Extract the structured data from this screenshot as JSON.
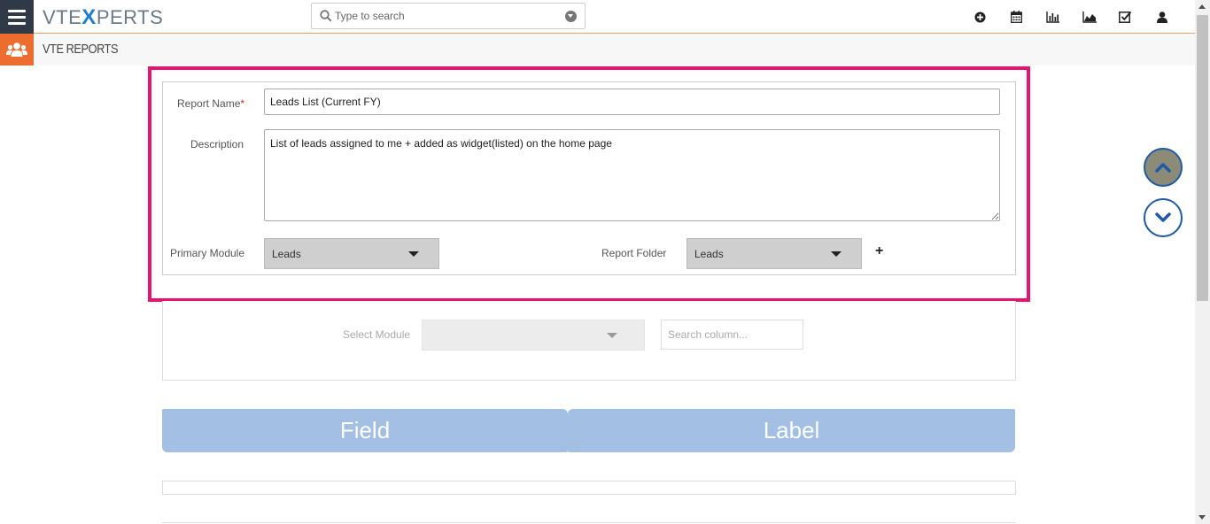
{
  "header": {
    "logo_left": "VTE",
    "logo_x": "X",
    "logo_right": "PERTS",
    "search_placeholder": "Type to search",
    "icons": [
      "plus-circle-icon",
      "calendar-icon",
      "bar-chart-icon",
      "area-chart-icon",
      "checkbox-icon",
      "user-icon"
    ]
  },
  "subheader": {
    "module_icon": "users-icon",
    "title": "VTE REPORTS"
  },
  "form": {
    "report_name_label": "Report Name",
    "required_mark": "*",
    "report_name_value": "Leads List (Current FY)",
    "description_label": "Description",
    "description_value": "List of leads assigned to me + added as widget(listed) on the home page",
    "primary_module_label": "Primary Module",
    "primary_module_value": "Leads",
    "report_folder_label": "Report Folder",
    "report_folder_value": "Leads",
    "add_folder_label": "+"
  },
  "module_select": {
    "label": "Select Module",
    "value": "",
    "search_placeholder": "Search column..."
  },
  "columns": {
    "field": "Field",
    "label": "Label"
  },
  "colors": {
    "highlight": "#e8136e",
    "brand_dark": "#2f3947",
    "module_orange": "#ec6d2e",
    "header_blue": "#a3bfe3",
    "scroll_border": "#1e5aa8"
  }
}
